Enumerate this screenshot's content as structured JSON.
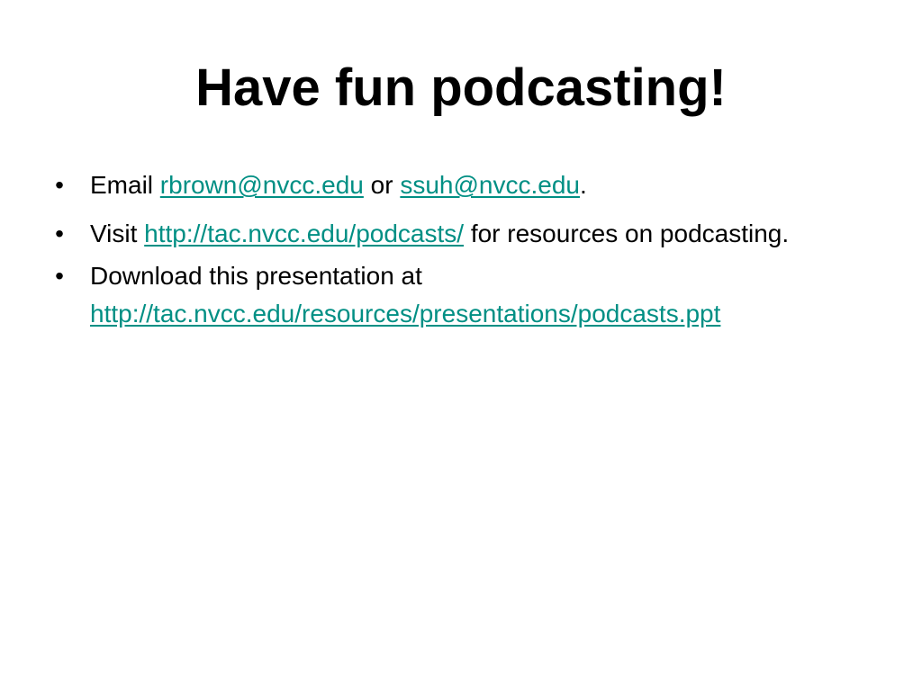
{
  "slide": {
    "title": "Have fun podcasting!",
    "bullet_glyph": "•",
    "bullets": [
      {
        "prefix": "Email ",
        "link1": "rbrown@nvcc.edu",
        "middle": " or ",
        "link2": "ssuh@nvcc.edu",
        "suffix": "."
      },
      {
        "prefix": "Visit ",
        "link": "http://tac.nvcc.edu/podcasts/",
        "suffix": " for resources on podcasting."
      },
      {
        "prefix": "Download this presentation at ",
        "link": "http://tac.nvcc.edu/resources/presentations/podcasts.ppt"
      }
    ]
  },
  "colors": {
    "background": "#ffffff",
    "text": "#000000",
    "link": "#008f84"
  }
}
